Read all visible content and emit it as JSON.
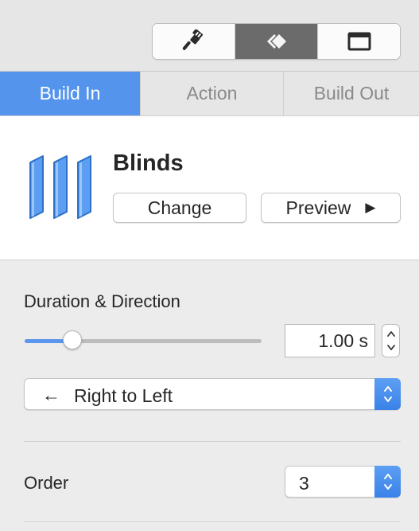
{
  "inspector_tabs": [
    {
      "icon": "paintbrush-icon",
      "active": false
    },
    {
      "icon": "animate-diamond-icon",
      "active": true
    },
    {
      "icon": "document-frame-icon",
      "active": false
    }
  ],
  "build_tabs": {
    "build_in": "Build In",
    "action": "Action",
    "build_out": "Build Out",
    "active": "build_in"
  },
  "effect": {
    "name": "Blinds",
    "thumbnail_icon": "blinds-effect-icon",
    "change_label": "Change",
    "preview_label": "Preview",
    "preview_icon": "play-icon"
  },
  "duration": {
    "title": "Duration & Direction",
    "value": "1.00 s",
    "slider_fraction": 0.2,
    "direction_icon": "arrow-left-icon",
    "direction": "Right to Left"
  },
  "order": {
    "label": "Order",
    "value": "3"
  },
  "colors": {
    "accent": "#5494ec",
    "active_segment": "#6b6b6b",
    "blinds_fill": "#5b9ef2"
  }
}
